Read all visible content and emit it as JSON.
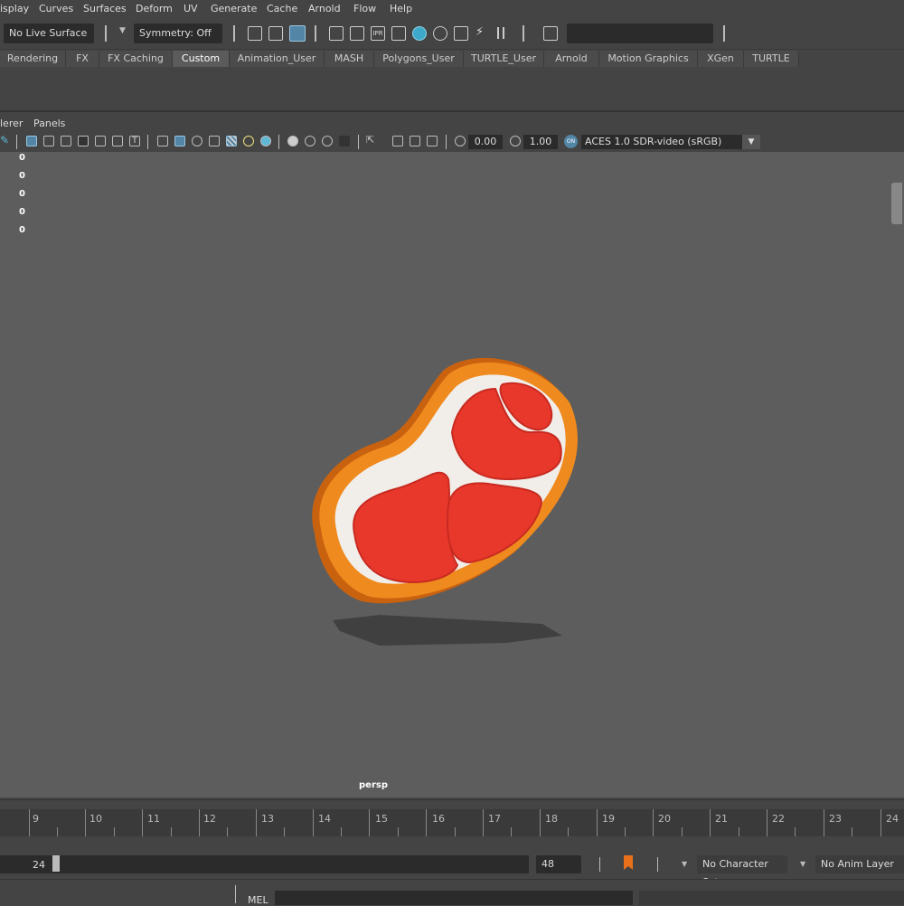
{
  "menubar": {
    "items": [
      "isplay",
      "Curves",
      "Surfaces",
      "Deform",
      "UV",
      "Generate",
      "Cache",
      "Arnold",
      "Flow",
      "Help"
    ]
  },
  "statusline": {
    "live_surface": "No Live Surface",
    "symmetry": "Symmetry: Off",
    "ipr_label": "IPR"
  },
  "shelf": {
    "tabs": [
      "Rendering",
      "FX",
      "FX Caching",
      "Custom",
      "Animation_User",
      "MASH",
      "Polygons_User",
      "TURTLE_User",
      "Arnold",
      "Motion Graphics",
      "XGen",
      "TURTLE"
    ],
    "active_tab": "Custom"
  },
  "panel": {
    "menus": [
      "lerer",
      "Panels"
    ],
    "exposure": "0.00",
    "gamma": "1.00",
    "color_space": "ACES 1.0 SDR-video (sRGB)",
    "on_badge": "ON"
  },
  "viewport": {
    "hud_values": [
      "0",
      "0",
      "0",
      "0",
      "0"
    ],
    "camera": "persp",
    "model": "steak-icon",
    "colors": {
      "background": "#5d5d5d",
      "meat": "#e8382c",
      "fat": "#f1eeea",
      "rind": "#e8801a"
    }
  },
  "timeslider": {
    "frames": [
      "9",
      "10",
      "11",
      "12",
      "13",
      "14",
      "15",
      "16",
      "17",
      "18",
      "19",
      "20",
      "21",
      "22",
      "23",
      "24"
    ]
  },
  "rangeslider": {
    "start": "24",
    "end": "48",
    "character_set": "No Character Set",
    "anim_layer": "No Anim Layer"
  },
  "cmdline": {
    "lang": "MEL"
  }
}
